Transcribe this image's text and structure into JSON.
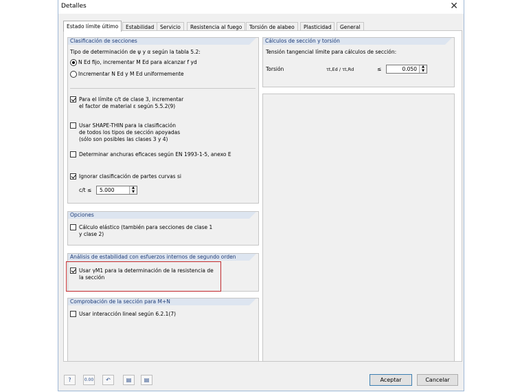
{
  "window": {
    "title": "Detalles"
  },
  "tabs": [
    "Estado límite último",
    "Estabilidad",
    "Servicio",
    "Resistencia al fuego",
    "Torsión de alabeo",
    "Plasticidad",
    "General"
  ],
  "clasificacion": {
    "header": "Clasificación de secciones",
    "tipo_label": "Tipo de determinación de ψ y α según la tabla 5.2:",
    "radio1": "N Ed fijo, incrementar M Ed para alcanzar f yd",
    "radio2": "Incrementar N Ed y M Ed uniformemente",
    "chk1_line1": "Para el límite c/t de clase 3, incrementar",
    "chk1_line2": "el factor de material ε según 5.5.2(9)",
    "chk2_line1": "Usar SHAPE-THIN para la clasificación",
    "chk2_line2": "de todos los tipos de sección apoyadas",
    "chk2_line3": "(sólo son posibles las clases 3 y 4)",
    "chk3": "Determinar anchuras eficaces según EN 1993-1-5, anexo E",
    "chk4": "Ignorar clasificación de partes curvas si",
    "ct_label": "c/t ≤",
    "ct_value": "5.000"
  },
  "opciones": {
    "header": "Opciones",
    "chk_line1": "Cálculo elástico (también para secciones de clase 1",
    "chk_line2": "y clase 2)"
  },
  "estabilidad": {
    "header": "Análisis de estabilidad con esfuerzos internos de segundo orden",
    "chk_line1": "Usar γM1 para la determinación de la resistencia de",
    "chk_line2": "la sección"
  },
  "comprobacion": {
    "header": "Comprobación de la sección para M+N",
    "chk": "Usar interacción lineal según 6.2.1(7)"
  },
  "calculos": {
    "header": "Cálculos de sección y torsión",
    "tension_label": "Tensión tangencial límite para cálculos de sección:",
    "torsion_label": "Torsión",
    "ratio_label": "τt,Ed / τt,Rd",
    "le": "≤",
    "value": "0.050"
  },
  "footer": {
    "tool_icons": [
      "help-icon",
      "units-icon",
      "undo-icon",
      "load-defaults-icon",
      "save-defaults-icon"
    ],
    "accept": "Aceptar",
    "cancel": "Cancelar"
  }
}
